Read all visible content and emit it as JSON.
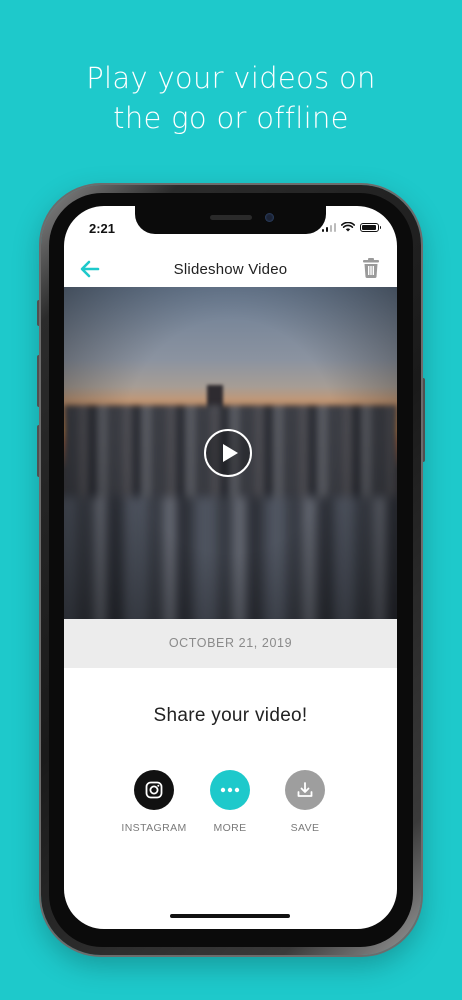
{
  "headline": {
    "line1": "Play your videos on",
    "line2": "the go or offline"
  },
  "status_bar": {
    "time": "2:21"
  },
  "navbar": {
    "title": "Slideshow Video",
    "back_icon": "arrow-left-icon",
    "delete_icon": "trash-icon"
  },
  "video": {
    "play_icon": "play-icon"
  },
  "date_label": "OCTOBER 21, 2019",
  "share": {
    "title": "Share your video!",
    "items": [
      {
        "label": "INSTAGRAM",
        "icon": "instagram-icon",
        "color": "#111111"
      },
      {
        "label": "MORE",
        "icon": "more-dots-icon",
        "color": "#1ec9cb"
      },
      {
        "label": "SAVE",
        "icon": "download-icon",
        "color": "#9e9e9e"
      }
    ]
  },
  "colors": {
    "background": "#1ec9cb",
    "accent": "#1ec9cb"
  }
}
